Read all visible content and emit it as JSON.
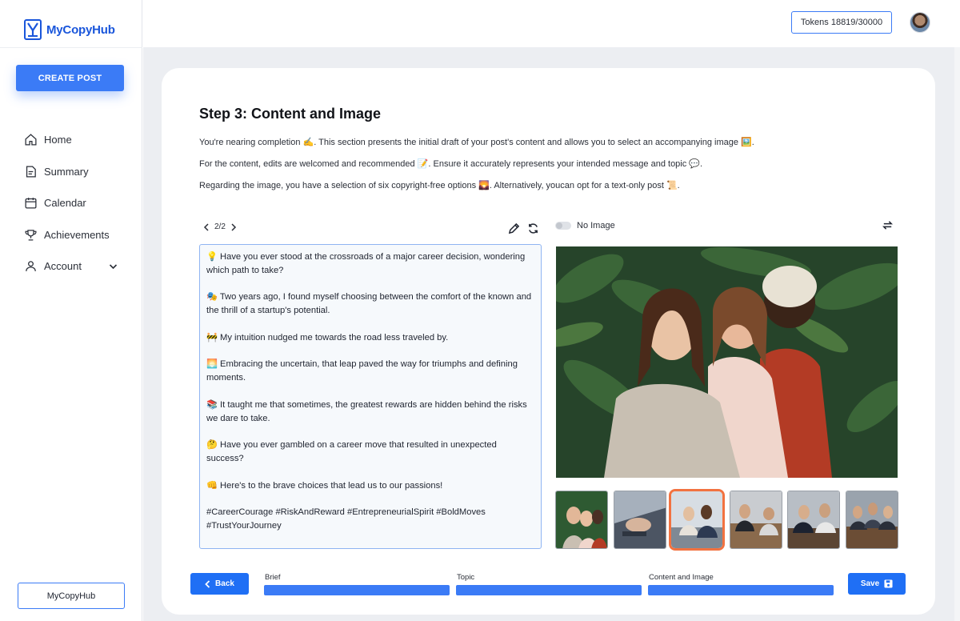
{
  "app": {
    "name": "MyCopyHub",
    "brand_color": "#1a56db",
    "accent": "#3b7bf6"
  },
  "sidebar": {
    "create_button": "CREATE POST",
    "items": [
      {
        "label": "Home",
        "icon": "home-icon"
      },
      {
        "label": "Summary",
        "icon": "document-icon"
      },
      {
        "label": "Calendar",
        "icon": "calendar-icon"
      },
      {
        "label": "Achievements",
        "icon": "trophy-icon"
      },
      {
        "label": "Account",
        "icon": "user-icon"
      }
    ],
    "footer_button": "MyCopyHub"
  },
  "header": {
    "tokens": "Tokens 18819/30000"
  },
  "step": {
    "title": "Step 3: Content and Image",
    "intro": [
      "You're nearing completion ✍️. This section presents the initial draft of your post's content and allows you to select an accompanying image 🖼️.",
      "For the content, edits are welcomed and recommended 📝. Ensure it accurately represents your intended message and topic 💬.",
      "Regarding the image, you have a selection of six copyright-free options 🌄. Alternatively, youcan opt for a text-only post 📜."
    ]
  },
  "editor": {
    "pager": "2/2",
    "content": "💡 Have you ever stood at the crossroads of a major career decision, wondering which path to take?\n\n🎭 Two years ago, I found myself choosing between the comfort of the known and the thrill of a startup's potential.\n\n🚧 My intuition nudged me towards the road less traveled by.\n\n🌅 Embracing the uncertain, that leap paved the way for triumphs and defining moments.\n\n📚 It taught me that sometimes, the greatest rewards are hidden behind the risks we dare to take.\n\n🤔 Have you ever gambled on a career move that resulted in unexpected success?\n\n👊 Here's to the brave choices that lead us to our passions!\n\n#CareerCourage #RiskAndReward #EntrepreneurialSpirit #BoldMoves #TrustYourJourney"
  },
  "image_panel": {
    "toggle_label": "No Image",
    "selected_index": 2,
    "thumbnails": [
      "thumbnail-1",
      "thumbnail-2",
      "thumbnail-3",
      "thumbnail-4",
      "thumbnail-5",
      "thumbnail-6"
    ]
  },
  "footer": {
    "back": "Back",
    "save": "Save",
    "steps": [
      "Brief",
      "Topic",
      "Content and Image"
    ]
  }
}
